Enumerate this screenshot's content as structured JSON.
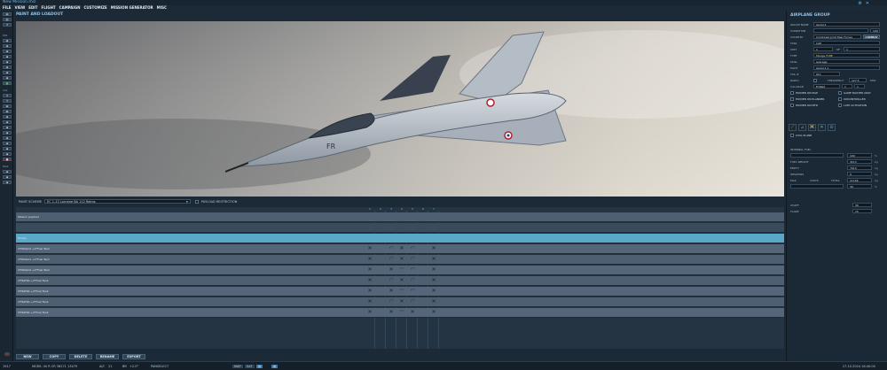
{
  "app": {
    "title": "New Mission.miz"
  },
  "menu": [
    "FILE",
    "VIEW",
    "EDIT",
    "FLIGHT",
    "CAMPAIGN",
    "CUSTOMIZE",
    "MISSION GENERATOR",
    "MISC"
  ],
  "left_toolbar": {
    "labels": [
      "MIS",
      "CAL",
      "MAP"
    ]
  },
  "main": {
    "title": "PAINT AND LOADOUT",
    "aircraft_marking": "FR",
    "scheme_label": "PAINT SCHEME",
    "scheme_value": "EC 1-13 Lorraine BA 112 Reims",
    "payload_restriction": "PAYLOAD RESTRICTION",
    "columns": [
      "1",
      "2",
      "3",
      "4",
      "5",
      "6",
      "7"
    ],
    "rows": [
      {
        "label": "Mission payload",
        "marks": []
      },
      {
        "label": "",
        "marks": []
      },
      {
        "label": "Empty",
        "marks": [],
        "selected": true
      },
      {
        "label": "2*MAGIC2 +2*Fuel Tank",
        "marks": [
          "x",
          "",
          "o",
          "x",
          "o",
          "",
          "x"
        ]
      },
      {
        "label": "2*MAGIC2 +2*Fuel Tank",
        "marks": [
          "x",
          "",
          "o",
          "x",
          "o",
          "",
          "x"
        ]
      },
      {
        "label": "2*MAGIC2 +2*Fuel Tank",
        "marks": [
          "x",
          "",
          "x",
          "o",
          "o",
          "",
          "x"
        ]
      },
      {
        "label": "2*MATRA +2*Fuel Tank",
        "marks": [
          "x",
          "",
          "o",
          "x",
          "o",
          "",
          "x"
        ]
      },
      {
        "label": "2*MATRA +2*Fuel Tank",
        "marks": [
          "x",
          "",
          "x",
          "o",
          "o",
          "",
          "x"
        ]
      },
      {
        "label": "2*MATRA +2*Fuel Tank",
        "marks": [
          "x",
          "",
          "o",
          "x",
          "o",
          "",
          "x"
        ]
      },
      {
        "label": "2*MATRA +2*Fuel Tank",
        "marks": [
          "x",
          "",
          "x",
          "o",
          "x",
          "",
          "x"
        ]
      }
    ],
    "buttons": {
      "new": "NEW",
      "copy": "COPY",
      "delete": "DELETE",
      "rename": "RENAME",
      "export": "EXPORT"
    }
  },
  "status": {
    "year": "1917",
    "coords": "MGRS: 40 R CR 36271 13479",
    "alt_label": "ALT",
    "alt_value": "21",
    "brg_label": "BR",
    "brg_value": "+2.0°",
    "mode": "PANSELECT",
    "map_btn": "MAP",
    "sat_btn": "SAT",
    "date": "27.10.2024 16:40:00"
  },
  "right_panel": {
    "title": "AIRPLANE GROUP",
    "group_name_label": "GROUP NAME",
    "group_name": "Aerial-1",
    "condition_label": "CONDITION",
    "condition_value": "100",
    "country_label": "COUNTRY",
    "country": "Combined Joint Task Forces",
    "combat_btn": "COMBAT",
    "task_label": "TASK",
    "task": "CAP",
    "unit_label": "UNIT",
    "unit": "1",
    "of_label": "OF",
    "of_value": "1",
    "type_label": "TYPE",
    "type": "Mirage F1BE",
    "skill_label": "SKILL",
    "skill": "Average",
    "pilot_label": "PILOT",
    "pilot": "Aerial-1-1",
    "tail_label": "TAIL #",
    "tail": "011",
    "radio_label": "RADIO",
    "frequency_label": "FREQUENCY",
    "frequency": "127.5",
    "mhz": "MHz",
    "callsign_label": "CALLSIGN",
    "callsign": "Enfield",
    "callsign_num": "1",
    "callsign_num2": "1",
    "checks": [
      "HIDDEN ON MAP",
      "GAME MASTER ONLY",
      "HIDDEN ON PLANNER",
      "UNCONTROLLED",
      "HIDDEN ON MFD",
      "LATE ACTIVATION"
    ],
    "civil_plane": "CIVIL PLANE",
    "internal_fuel_label": "INTERNAL FUEL",
    "fuel_weight_label": "FUEL WEIGHT",
    "fuel_weight": "3213",
    "empty_label": "EMPTY",
    "empty_value": "7913",
    "weapons_label": "WEAPONS",
    "weapons_value": "0",
    "max_label": "MAX",
    "max_value": "15976",
    "total_label": "TOTAL",
    "total_value": "11126",
    "fuel_pct": "100",
    "pct_unit": "%",
    "kg_unit": "kg",
    "chaff_label": "CHAFF",
    "chaff_value": "30",
    "flare_label": "FLARE",
    "flare_value": "15",
    "accent": "#6fb7e6"
  }
}
